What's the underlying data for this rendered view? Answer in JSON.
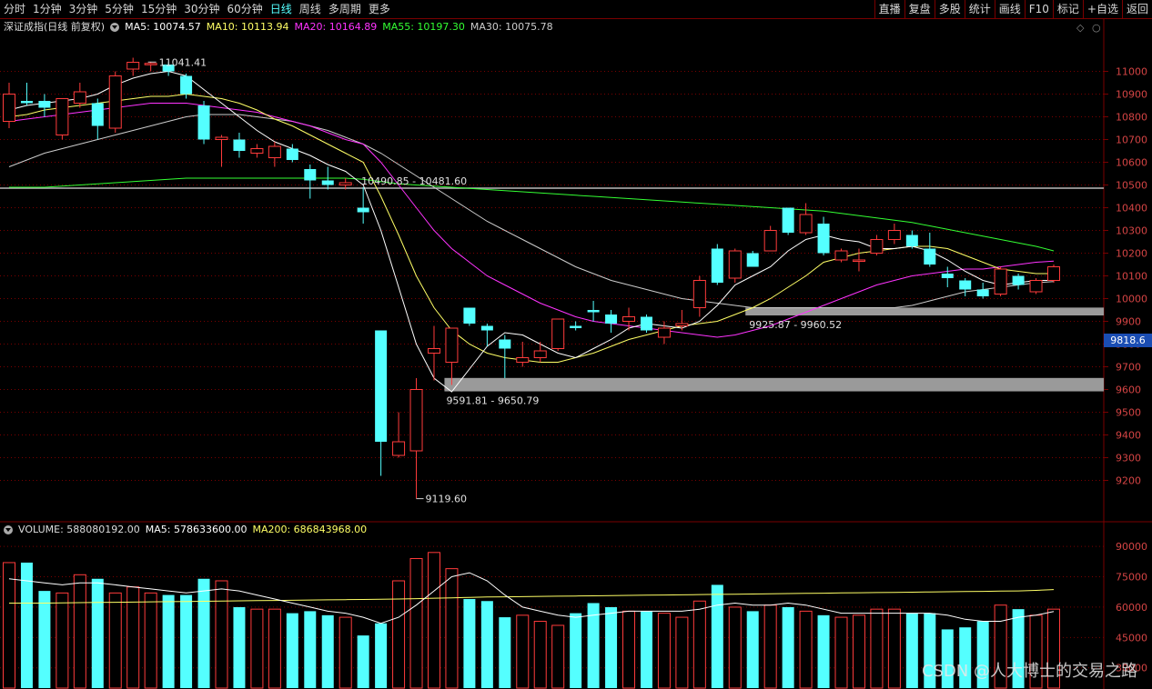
{
  "toolbar": {
    "left_items": [
      "分时",
      "1分钟",
      "3分钟",
      "5分钟",
      "15分钟",
      "30分钟",
      "60分钟",
      "日线",
      "周线",
      "多周期",
      "更多"
    ],
    "active_index": 7,
    "right_items": [
      "直播",
      "复盘",
      "多股",
      "统计",
      "画线",
      "F10",
      "标记",
      "+自选",
      "返回"
    ]
  },
  "price_header": {
    "title": "深证成指(日线 前复权)",
    "ma5": "MA5: 10074.57",
    "ma10": "MA10: 10113.94",
    "ma20": "MA20: 10164.89",
    "ma55": "MA55: 10197.30",
    "ma30": "MA30: 10075.78"
  },
  "volume_header": {
    "volume": "VOLUME: 588080192.00",
    "ma5": "MA5: 578633600.00",
    "ma200": "MA200: 686843968.00"
  },
  "colors": {
    "up": "#ff3b3b",
    "down": "#54ffff",
    "ma5": "#ffffff",
    "ma10": "#ffff66",
    "ma20": "#ff33ff",
    "ma55": "#33ff33",
    "ma30": "#cccccc",
    "axis": "#d44444",
    "grid": "#7a0000"
  },
  "current_price": "9818.6",
  "watermark": "CSDN @人大博士的交易之路",
  "annotations": {
    "high": "11041.41",
    "low": "9119.60",
    "zone1": "10490.85 - 10481.60",
    "zone2": "9925.87 - 9960.52",
    "zone3": "9591.81 - 9650.79"
  },
  "chart_data": [
    {
      "type": "candlestick",
      "title": "深证成指(日线 前复权)",
      "ylim": [
        9050,
        11150
      ],
      "yticks": [
        9200,
        9300,
        9400,
        9500,
        9600,
        9700,
        9800,
        9900,
        10000,
        10100,
        10200,
        10300,
        10400,
        10500,
        10600,
        10700,
        10800,
        10900,
        11000
      ],
      "candles": [
        {
          "o": 10780,
          "h": 10950,
          "l": 10750,
          "c": 10900
        },
        {
          "o": 10870,
          "h": 10950,
          "l": 10850,
          "c": 10860
        },
        {
          "o": 10870,
          "h": 10900,
          "l": 10800,
          "c": 10840
        },
        {
          "o": 10720,
          "h": 10880,
          "l": 10700,
          "c": 10880
        },
        {
          "o": 10860,
          "h": 10950,
          "l": 10840,
          "c": 10910
        },
        {
          "o": 10860,
          "h": 10880,
          "l": 10700,
          "c": 10760
        },
        {
          "o": 10750,
          "h": 11000,
          "l": 10730,
          "c": 10980
        },
        {
          "o": 11010,
          "h": 11060,
          "l": 10980,
          "c": 11040
        },
        {
          "o": 11030,
          "h": 11041,
          "l": 11000,
          "c": 11035
        },
        {
          "o": 11030,
          "h": 11040,
          "l": 10980,
          "c": 11000
        },
        {
          "o": 10980,
          "h": 10990,
          "l": 10880,
          "c": 10900
        },
        {
          "o": 10850,
          "h": 10870,
          "l": 10680,
          "c": 10700
        },
        {
          "o": 10700,
          "h": 10720,
          "l": 10580,
          "c": 10710
        },
        {
          "o": 10700,
          "h": 10730,
          "l": 10620,
          "c": 10650
        },
        {
          "o": 10640,
          "h": 10680,
          "l": 10620,
          "c": 10660
        },
        {
          "o": 10620,
          "h": 10690,
          "l": 10580,
          "c": 10670
        },
        {
          "o": 10660,
          "h": 10680,
          "l": 10600,
          "c": 10610
        },
        {
          "o": 10570,
          "h": 10590,
          "l": 10440,
          "c": 10520
        },
        {
          "o": 10520,
          "h": 10580,
          "l": 10480,
          "c": 10500
        },
        {
          "o": 10500,
          "h": 10530,
          "l": 10480,
          "c": 10510
        },
        {
          "o": 10400,
          "h": 10490,
          "l": 10330,
          "c": 10380
        },
        {
          "o": 9860,
          "h": 9830,
          "l": 9220,
          "c": 9370
        },
        {
          "o": 9310,
          "h": 9500,
          "l": 9300,
          "c": 9370
        },
        {
          "o": 9330,
          "h": 9650,
          "l": 9120,
          "c": 9600
        },
        {
          "o": 9760,
          "h": 9880,
          "l": 9640,
          "c": 9780
        },
        {
          "o": 9720,
          "h": 9870,
          "l": 9620,
          "c": 9870
        },
        {
          "o": 9960,
          "h": 9960,
          "l": 9880,
          "c": 9890
        },
        {
          "o": 9880,
          "h": 9890,
          "l": 9790,
          "c": 9860
        },
        {
          "o": 9820,
          "h": 9840,
          "l": 9650,
          "c": 9780
        },
        {
          "o": 9720,
          "h": 9810,
          "l": 9700,
          "c": 9740
        },
        {
          "o": 9740,
          "h": 9810,
          "l": 9720,
          "c": 9770
        },
        {
          "o": 9780,
          "h": 9910,
          "l": 9770,
          "c": 9910
        },
        {
          "o": 9880,
          "h": 9900,
          "l": 9860,
          "c": 9870
        },
        {
          "o": 9950,
          "h": 9990,
          "l": 9900,
          "c": 9940
        },
        {
          "o": 9930,
          "h": 9950,
          "l": 9850,
          "c": 9890
        },
        {
          "o": 9900,
          "h": 9960,
          "l": 9860,
          "c": 9920
        },
        {
          "o": 9920,
          "h": 9930,
          "l": 9850,
          "c": 9860
        },
        {
          "o": 9830,
          "h": 9900,
          "l": 9800,
          "c": 9870
        },
        {
          "o": 9880,
          "h": 9950,
          "l": 9860,
          "c": 9890
        },
        {
          "o": 9960,
          "h": 10100,
          "l": 9920,
          "c": 10080
        },
        {
          "o": 10220,
          "h": 10240,
          "l": 10060,
          "c": 10070
        },
        {
          "o": 10090,
          "h": 10220,
          "l": 10070,
          "c": 10210
        },
        {
          "o": 10200,
          "h": 10210,
          "l": 10140,
          "c": 10140
        },
        {
          "o": 10210,
          "h": 10320,
          "l": 10210,
          "c": 10300
        },
        {
          "o": 10400,
          "h": 10400,
          "l": 10280,
          "c": 10290
        },
        {
          "o": 10290,
          "h": 10420,
          "l": 10280,
          "c": 10370
        },
        {
          "o": 10330,
          "h": 10360,
          "l": 10190,
          "c": 10200
        },
        {
          "o": 10170,
          "h": 10220,
          "l": 10160,
          "c": 10210
        },
        {
          "o": 10170,
          "h": 10220,
          "l": 10120,
          "c": 10170
        },
        {
          "o": 10200,
          "h": 10280,
          "l": 10190,
          "c": 10260
        },
        {
          "o": 10260,
          "h": 10330,
          "l": 10240,
          "c": 10300
        },
        {
          "o": 10280,
          "h": 10300,
          "l": 10220,
          "c": 10230
        },
        {
          "o": 10220,
          "h": 10290,
          "l": 10140,
          "c": 10150
        },
        {
          "o": 10110,
          "h": 10140,
          "l": 10050,
          "c": 10090
        },
        {
          "o": 10080,
          "h": 10090,
          "l": 10010,
          "c": 10040
        },
        {
          "o": 10040,
          "h": 10070,
          "l": 10000,
          "c": 10010
        },
        {
          "o": 10020,
          "h": 10140,
          "l": 10010,
          "c": 10130
        },
        {
          "o": 10100,
          "h": 10110,
          "l": 10040,
          "c": 10060
        },
        {
          "o": 10030,
          "h": 10090,
          "l": 10020,
          "c": 10080
        },
        {
          "o": 10080,
          "h": 10150,
          "l": 10070,
          "c": 10140
        }
      ],
      "ma5": [
        10830,
        10850,
        10860,
        10870,
        10880,
        10900,
        10940,
        10970,
        10990,
        11000,
        10980,
        10920,
        10860,
        10800,
        10740,
        10690,
        10660,
        10630,
        10590,
        10560,
        10500,
        10300,
        10050,
        9800,
        9650,
        9590,
        9690,
        9790,
        9850,
        9840,
        9800,
        9760,
        9740,
        9780,
        9820,
        9870,
        9890,
        9880,
        9870,
        9900,
        9970,
        10060,
        10100,
        10140,
        10210,
        10260,
        10280,
        10260,
        10250,
        10220,
        10220,
        10230,
        10210,
        10170,
        10120,
        10080,
        10060,
        10070,
        10080,
        10080
      ],
      "ma10": [
        10800,
        10810,
        10830,
        10840,
        10850,
        10860,
        10870,
        10880,
        10890,
        10890,
        10900,
        10890,
        10880,
        10860,
        10830,
        10790,
        10760,
        10720,
        10680,
        10640,
        10600,
        10450,
        10280,
        10100,
        9960,
        9860,
        9800,
        9760,
        9740,
        9730,
        9720,
        9720,
        9740,
        9760,
        9790,
        9820,
        9840,
        9860,
        9880,
        9890,
        9900,
        9930,
        9960,
        10000,
        10050,
        10100,
        10160,
        10180,
        10200,
        10210,
        10220,
        10230,
        10230,
        10220,
        10190,
        10160,
        10130,
        10120,
        10110,
        10110
      ],
      "ma20": [
        10780,
        10790,
        10800,
        10810,
        10820,
        10830,
        10840,
        10850,
        10860,
        10860,
        10860,
        10850,
        10840,
        10830,
        10820,
        10800,
        10780,
        10760,
        10730,
        10700,
        10680,
        10600,
        10500,
        10400,
        10300,
        10220,
        10160,
        10100,
        10060,
        10020,
        9980,
        9950,
        9920,
        9900,
        9890,
        9880,
        9870,
        9860,
        9850,
        9840,
        9830,
        9840,
        9860,
        9880,
        9910,
        9940,
        9970,
        10000,
        10030,
        10060,
        10080,
        10100,
        10110,
        10120,
        10130,
        10130,
        10140,
        10150,
        10160,
        10165
      ],
      "ma55": [
        10490,
        10490,
        10490,
        10495,
        10500,
        10505,
        10510,
        10515,
        10520,
        10525,
        10530,
        10530,
        10530,
        10530,
        10530,
        10530,
        10530,
        10530,
        10530,
        10530,
        10525,
        10515,
        10505,
        10500,
        10495,
        10490,
        10485,
        10480,
        10475,
        10470,
        10465,
        10460,
        10455,
        10450,
        10445,
        10440,
        10435,
        10430,
        10425,
        10420,
        10415,
        10410,
        10405,
        10400,
        10395,
        10390,
        10385,
        10375,
        10365,
        10355,
        10345,
        10335,
        10320,
        10305,
        10290,
        10275,
        10260,
        10245,
        10230,
        10210
      ],
      "ma30": [
        10580,
        10610,
        10640,
        10660,
        10680,
        10700,
        10720,
        10740,
        10760,
        10780,
        10800,
        10810,
        10810,
        10810,
        10800,
        10790,
        10780,
        10760,
        10740,
        10710,
        10680,
        10640,
        10590,
        10540,
        10490,
        10440,
        10390,
        10340,
        10300,
        10260,
        10220,
        10180,
        10140,
        10110,
        10080,
        10060,
        10040,
        10020,
        10000,
        9990,
        9980,
        9970,
        9960,
        9960,
        9960,
        9960,
        9960,
        9960,
        9960,
        9960,
        9960,
        9970,
        9990,
        10010,
        10030,
        10040,
        10050,
        10060,
        10070,
        10075
      ]
    },
    {
      "type": "bar",
      "title": "VOLUME",
      "ylim": [
        20000,
        95000
      ],
      "yticks": [
        30000,
        45000,
        60000,
        75000,
        90000
      ],
      "values": [
        82000,
        82000,
        68000,
        67000,
        76000,
        74000,
        67000,
        70000,
        67000,
        66000,
        66000,
        74000,
        73000,
        60000,
        59000,
        59000,
        57000,
        58000,
        56000,
        55000,
        46000,
        52000,
        73000,
        84000,
        87000,
        79000,
        64000,
        63000,
        55000,
        56000,
        53000,
        51000,
        57000,
        62000,
        60000,
        58000,
        58000,
        57000,
        55000,
        63000,
        71000,
        60000,
        58000,
        61000,
        60000,
        58000,
        56000,
        55000,
        56000,
        59000,
        59000,
        57000,
        57000,
        49000,
        50000,
        53000,
        61000,
        59000,
        56000,
        59000
      ],
      "ma5": [
        74000,
        73000,
        72000,
        71000,
        72000,
        72000,
        71000,
        70000,
        69000,
        68000,
        67000,
        68000,
        69000,
        68000,
        66000,
        64000,
        62000,
        60000,
        58000,
        57000,
        55000,
        52000,
        55000,
        61000,
        68000,
        75000,
        77000,
        73000,
        66000,
        60000,
        58000,
        56000,
        55000,
        56000,
        57000,
        58000,
        58000,
        58000,
        58000,
        59000,
        61000,
        62000,
        61000,
        61000,
        62000,
        61000,
        59000,
        57000,
        57000,
        57000,
        57000,
        57000,
        57000,
        56000,
        54000,
        53000,
        53000,
        55000,
        56000,
        57800
      ],
      "ma200": [
        62000,
        62000,
        62000,
        62100,
        62200,
        62300,
        62400,
        62500,
        62600,
        62700,
        62800,
        62900,
        63000,
        63100,
        63200,
        63300,
        63400,
        63500,
        63600,
        63700,
        63800,
        63900,
        64000,
        64200,
        64400,
        64600,
        64800,
        65000,
        65100,
        65200,
        65300,
        65400,
        65500,
        65600,
        65700,
        65800,
        65900,
        66000,
        66100,
        66200,
        66300,
        66400,
        66500,
        66600,
        66700,
        66800,
        66900,
        67000,
        67100,
        67200,
        67300,
        67400,
        67500,
        67600,
        67700,
        67800,
        67900,
        68000,
        68300,
        68684
      ]
    }
  ]
}
